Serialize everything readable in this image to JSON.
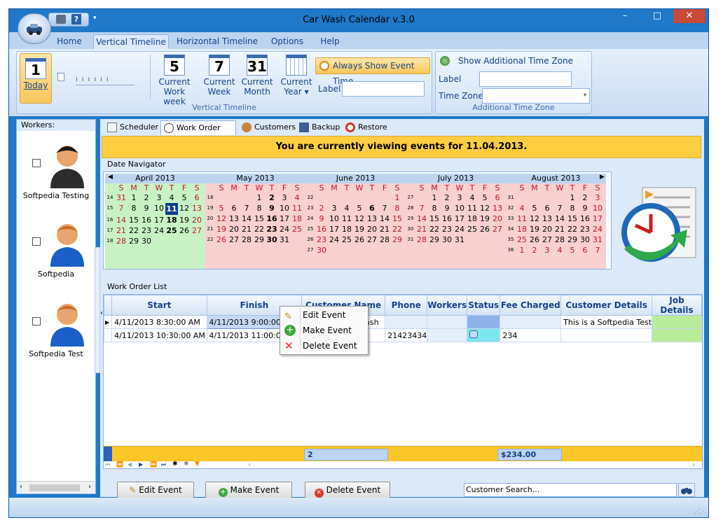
{
  "window": {
    "title": "Car Wash Calendar v.3.0"
  },
  "menu": {
    "tabs": [
      "Home",
      "Vertical Timeline",
      "Horizontal Timeline",
      "Options",
      "Help"
    ],
    "active": "Vertical Timeline"
  },
  "ribbon": {
    "today_label": "Today",
    "today_day": "1",
    "buttons": [
      {
        "icon_text": "5",
        "label1": "Current",
        "label2": "Work week"
      },
      {
        "icon_text": "7",
        "label1": "Current",
        "label2": "Week"
      },
      {
        "icon_text": "31",
        "label1": "Current",
        "label2": "Month"
      },
      {
        "icon_text": "",
        "label1": "Current",
        "label2": "Year ▾"
      }
    ],
    "always_show": "Always Show Event Time",
    "label_caption": "Label",
    "group1_label": "Vertical Timeline",
    "tz_show": "Show Additional Time Zone",
    "tz_label_caption": "Label",
    "tz_zone_caption": "Time Zone",
    "group2_label": "Additional Time Zone"
  },
  "workers": {
    "header": "Workers:",
    "items": [
      "Softpedia Testing",
      "Softpedia",
      "Softpedia Test"
    ]
  },
  "subtabs": [
    "Scheduler",
    "Work Order List",
    "Customers",
    "Backup",
    "Restore"
  ],
  "banner": "You are currently viewing events for 11.04.2013.",
  "date_navigator": {
    "header": "Date Navigator",
    "dows": [
      "S",
      "M",
      "T",
      "W",
      "T",
      "F",
      "S"
    ],
    "months": [
      {
        "title": "April 2013",
        "weeks": [
          {
            "wk": "14",
            "days": [
              "31",
              "1",
              "2",
              "3",
              "4",
              "5",
              "6"
            ]
          },
          {
            "wk": "15",
            "days": [
              "7",
              "8",
              "9",
              "10",
              "11",
              "12",
              "13"
            ]
          },
          {
            "wk": "16",
            "days": [
              "14",
              "15",
              "16",
              "17",
              "18",
              "19",
              "20"
            ]
          },
          {
            "wk": "17",
            "days": [
              "21",
              "22",
              "23",
              "24",
              "25",
              "26",
              "27"
            ]
          },
          {
            "wk": "18",
            "days": [
              "28",
              "29",
              "30",
              "",
              "",
              "",
              ""
            ]
          }
        ]
      },
      {
        "title": "May 2013",
        "weeks": [
          {
            "wk": "18",
            "days": [
              "",
              "",
              "",
              "1",
              "2",
              "3",
              "4"
            ]
          },
          {
            "wk": "19",
            "days": [
              "5",
              "6",
              "7",
              "8",
              "9",
              "10",
              "11"
            ]
          },
          {
            "wk": "20",
            "days": [
              "12",
              "13",
              "14",
              "15",
              "16",
              "17",
              "18"
            ]
          },
          {
            "wk": "21",
            "days": [
              "19",
              "20",
              "21",
              "22",
              "23",
              "24",
              "25"
            ]
          },
          {
            "wk": "22",
            "days": [
              "26",
              "27",
              "28",
              "29",
              "30",
              "31",
              ""
            ]
          }
        ]
      },
      {
        "title": "June 2013",
        "weeks": [
          {
            "wk": "22",
            "days": [
              "",
              "",
              "",
              "",
              "",
              "",
              "1"
            ]
          },
          {
            "wk": "23",
            "days": [
              "2",
              "3",
              "4",
              "5",
              "6",
              "7",
              "8"
            ]
          },
          {
            "wk": "24",
            "days": [
              "9",
              "10",
              "11",
              "12",
              "13",
              "14",
              "15"
            ]
          },
          {
            "wk": "25",
            "days": [
              "16",
              "17",
              "18",
              "19",
              "20",
              "21",
              "22"
            ]
          },
          {
            "wk": "26",
            "days": [
              "23",
              "24",
              "25",
              "26",
              "27",
              "28",
              "29"
            ]
          },
          {
            "wk": "27",
            "days": [
              "30",
              "",
              "",
              "",
              "",
              "",
              ""
            ]
          }
        ]
      },
      {
        "title": "July 2013",
        "weeks": [
          {
            "wk": "27",
            "days": [
              "",
              "1",
              "2",
              "3",
              "4",
              "5",
              "6"
            ]
          },
          {
            "wk": "28",
            "days": [
              "7",
              "8",
              "9",
              "10",
              "11",
              "12",
              "13"
            ]
          },
          {
            "wk": "29",
            "days": [
              "14",
              "15",
              "16",
              "17",
              "18",
              "19",
              "20"
            ]
          },
          {
            "wk": "30",
            "days": [
              "21",
              "22",
              "23",
              "24",
              "25",
              "26",
              "27"
            ]
          },
          {
            "wk": "31",
            "days": [
              "28",
              "29",
              "30",
              "31",
              "",
              "",
              ""
            ]
          }
        ]
      },
      {
        "title": "August 2013",
        "weeks": [
          {
            "wk": "31",
            "days": [
              "",
              "",
              "",
              "",
              "1",
              "2",
              "3"
            ]
          },
          {
            "wk": "32",
            "days": [
              "4",
              "5",
              "6",
              "7",
              "8",
              "9",
              "10"
            ]
          },
          {
            "wk": "33",
            "days": [
              "11",
              "12",
              "13",
              "14",
              "15",
              "16",
              "17"
            ]
          },
          {
            "wk": "34",
            "days": [
              "18",
              "19",
              "20",
              "21",
              "22",
              "23",
              "24"
            ]
          },
          {
            "wk": "35",
            "days": [
              "25",
              "26",
              "27",
              "28",
              "29",
              "30",
              "31"
            ]
          },
          {
            "wk": "36",
            "days": [
              "1",
              "2",
              "3",
              "4",
              "5",
              "6",
              "7"
            ]
          }
        ]
      }
    ]
  },
  "work_order": {
    "header": "Work Order List",
    "columns": [
      "Start",
      "Finish",
      "Customer Name",
      "Phone",
      "Workers",
      "Status",
      "Fee Charged",
      "Customer Details",
      "Job Details"
    ],
    "rows": [
      {
        "start": "4/11/2013 8:30:00 AM",
        "finish": "4/11/2013 9:00:00 AM",
        "customer": "Softpedia Car wash",
        "phone": "",
        "workers": "",
        "status": "",
        "fee": "",
        "cdetails": "This is a Softpedia Test",
        "jdetails": ""
      },
      {
        "start": "4/11/2013 10:30:00 AM",
        "finish": "4/11/2013 11:00:00 AM",
        "customer": "",
        "phone": "21423434",
        "workers": "",
        "status": "",
        "fee": "234",
        "cdetails": "",
        "jdetails": ""
      }
    ],
    "footer_count": "2",
    "footer_fee": "$234.00"
  },
  "context_menu": [
    "Edit Event",
    "Make Event",
    "Delete Event"
  ],
  "bottom": {
    "edit": "Edit Event",
    "make": "Make Event",
    "delete": "Delete Event",
    "search_placeholder": "Customer Search..."
  },
  "colors": {
    "accent": "#1f78c8",
    "banner": "#fecd40",
    "selected_day": "#0a3e8e",
    "green_month": "#c8f2c4",
    "pink_month": "#f8d0d0"
  }
}
